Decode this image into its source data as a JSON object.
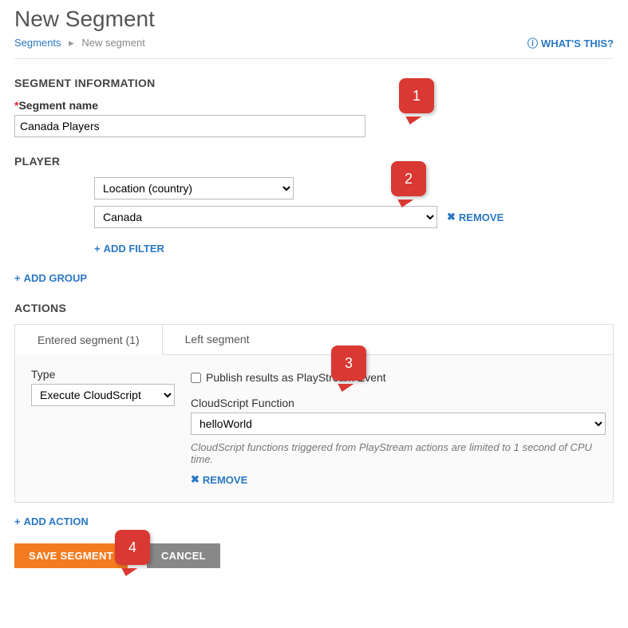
{
  "page": {
    "title": "New Segment",
    "breadcrumb_link": "Segments",
    "breadcrumb_current": "New segment",
    "whatsthis": "WHAT'S THIS?"
  },
  "segment_info": {
    "header": "SEGMENT INFORMATION",
    "name_label": "Segment name",
    "name_value": "Canada Players"
  },
  "player": {
    "header": "PLAYER",
    "filter_type": "Location (country)",
    "filter_value": "Canada",
    "remove": "REMOVE",
    "add_filter": "ADD FILTER",
    "add_group": "ADD GROUP"
  },
  "actions": {
    "header": "ACTIONS",
    "tab_entered": "Entered segment (1)",
    "tab_left": "Left segment",
    "type_label": "Type",
    "type_value": "Execute CloudScript",
    "publish_label": "Publish results as PlayStream Event",
    "fn_label": "CloudScript Function",
    "fn_value": "helloWorld",
    "note": "CloudScript functions triggered from PlayStream actions are limited to 1 second of CPU time.",
    "remove": "REMOVE",
    "add_action": "ADD ACTION"
  },
  "buttons": {
    "save": "SAVE SEGMENT",
    "cancel": "CANCEL"
  },
  "callouts": [
    "1",
    "2",
    "3",
    "4"
  ]
}
